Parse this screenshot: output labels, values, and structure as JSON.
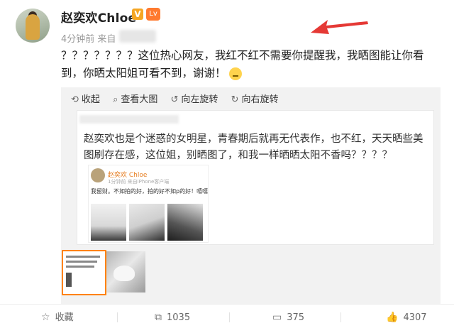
{
  "post": {
    "username": "赵奕欢Chloe",
    "verified_badge": "V",
    "level_badge": "Lv",
    "meta": "4分钟前 来自",
    "text": "？？？？？？？这位热心网友，我红不红不需要你提醒我，我晒图能让你看到，你晒太阳姐可看不到，谢谢！",
    "emoji_icon": "eye-roll-emoji"
  },
  "image_toolbar": {
    "collapse": "收起",
    "view_large": "查看大图",
    "rotate_left": "向左旋转",
    "rotate_right": "向右旋转"
  },
  "embedded_screenshot": {
    "comment_text": "赵奕欢也是个迷惑的女明星，青春期后就再无代表作，也不红，天天晒些美图刷存在感，这位姐，别晒图了，和我一样晒晒太阳不香吗？？？？",
    "inner_username": "赵奕欢 Chloe",
    "inner_meta": "1分钟前 来自iPhone客户端",
    "inner_text": "我留财。不如拍的好，拍的好不如p的好！嘻嘻"
  },
  "footer": {
    "favorite": "收藏",
    "repost_count": "1035",
    "comment_count": "375",
    "like_count": "4307"
  },
  "colors": {
    "accent_orange": "#ff8200",
    "arrow_red": "#e53935",
    "link_orange": "#e67e22"
  }
}
